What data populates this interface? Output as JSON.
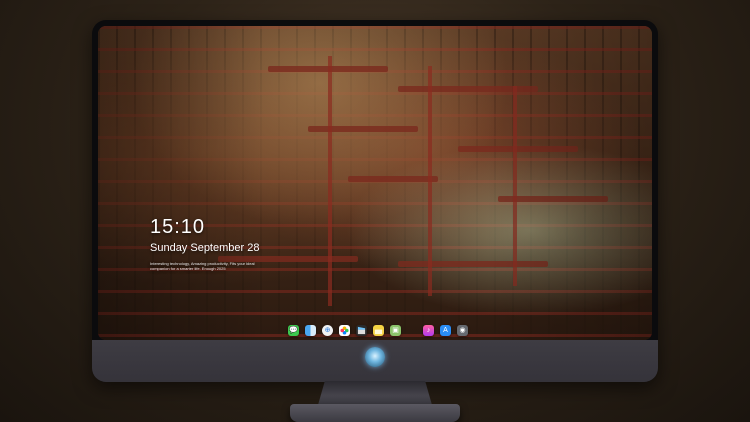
{
  "lock_screen": {
    "time": "15:10",
    "date": "Sunday September 28",
    "tagline": "Interesting technology, Amazing productivity, Fits your ideal companion for a smarter life. Enough 2025"
  },
  "dock": {
    "apps": [
      {
        "name": "messages-icon",
        "glyph": "💬"
      },
      {
        "name": "finder-icon",
        "glyph": ""
      },
      {
        "name": "safari-icon",
        "glyph": "⊕"
      },
      {
        "name": "photos-icon",
        "glyph": "✿"
      },
      {
        "name": "video-icon",
        "glyph": "▶"
      },
      {
        "name": "notes-icon",
        "glyph": ""
      },
      {
        "name": "preview-icon",
        "glyph": "▣"
      },
      {
        "name": "music-icon",
        "glyph": "♪"
      },
      {
        "name": "app-store-icon",
        "glyph": "A"
      },
      {
        "name": "camera-icon",
        "glyph": "◉"
      }
    ]
  },
  "colors": {
    "background": "#2d2318",
    "bezel": "#0b0b0d",
    "chin": "#3e3c43",
    "logo_glow": "#6fb6e0"
  }
}
